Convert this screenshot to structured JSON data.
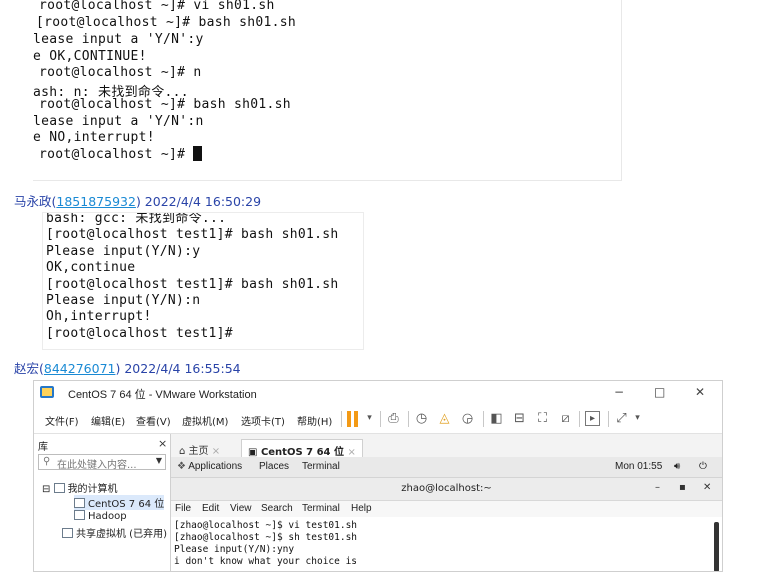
{
  "terminal1": {
    "lines": [
      "root@localhost ~]# vi sh01.sh",
      "[root@localhost ~]# bash sh01.sh",
      "lease input a 'Y/N':y",
      "e OK,CONTINUE!",
      "root@localhost ~]# n",
      "ash: n: 未找到命令...",
      "root@localhost ~]# bash sh01.sh",
      "lease input a 'Y/N':n",
      "e NO,interrupt!",
      "root@localhost ~]# "
    ]
  },
  "message1": {
    "name": "马永政",
    "id": "1851875932",
    "timestamp": "2022/4/4 16:50:29"
  },
  "terminal2": {
    "lines": [
      "bash: gcc: 未找到命令...",
      "[root@localhost test1]# bash sh01.sh",
      "Please input(Y/N):y",
      "OK,continue",
      "[root@localhost test1]# bash sh01.sh",
      "Please input(Y/N):n",
      "Oh,interrupt!",
      "[root@localhost test1]#"
    ]
  },
  "message2": {
    "name": "赵宏",
    "id": "844276071",
    "timestamp": "2022/4/4 16:55:54"
  },
  "vmware": {
    "title": "CentOS 7 64 位 - VMware Workstation",
    "window_buttons": {
      "minimize": "−",
      "maximize": "□",
      "close": "✕"
    },
    "menu": [
      "文件(F)",
      "编辑(E)",
      "查看(V)",
      "虚拟机(M)",
      "选项卡(T)",
      "帮助(H)"
    ],
    "library": {
      "header": "库",
      "close": "×",
      "search_placeholder": "在此处键入内容...",
      "tree": [
        "我的计算机",
        "CentOS 7 64 位",
        "Hadoop",
        "共享虚拟机 (已弃用)"
      ]
    },
    "tabs": [
      {
        "label": "主页",
        "close": "×"
      },
      {
        "label": "CentOS 7 64 位",
        "close": "×"
      }
    ],
    "gnome_bar": {
      "applications": "Applications",
      "places": "Places",
      "terminal": "Terminal",
      "clock": "Mon 01:55"
    },
    "terminal_window": {
      "title": "zhao@localhost:~",
      "menu": [
        "File",
        "Edit",
        "View",
        "Search",
        "Terminal",
        "Help"
      ],
      "lines": [
        "[zhao@localhost ~]$ vi test01.sh",
        "[zhao@localhost ~]$ sh test01.sh",
        "Please input(Y/N):yny",
        "i don't know what your choice is"
      ]
    }
  }
}
